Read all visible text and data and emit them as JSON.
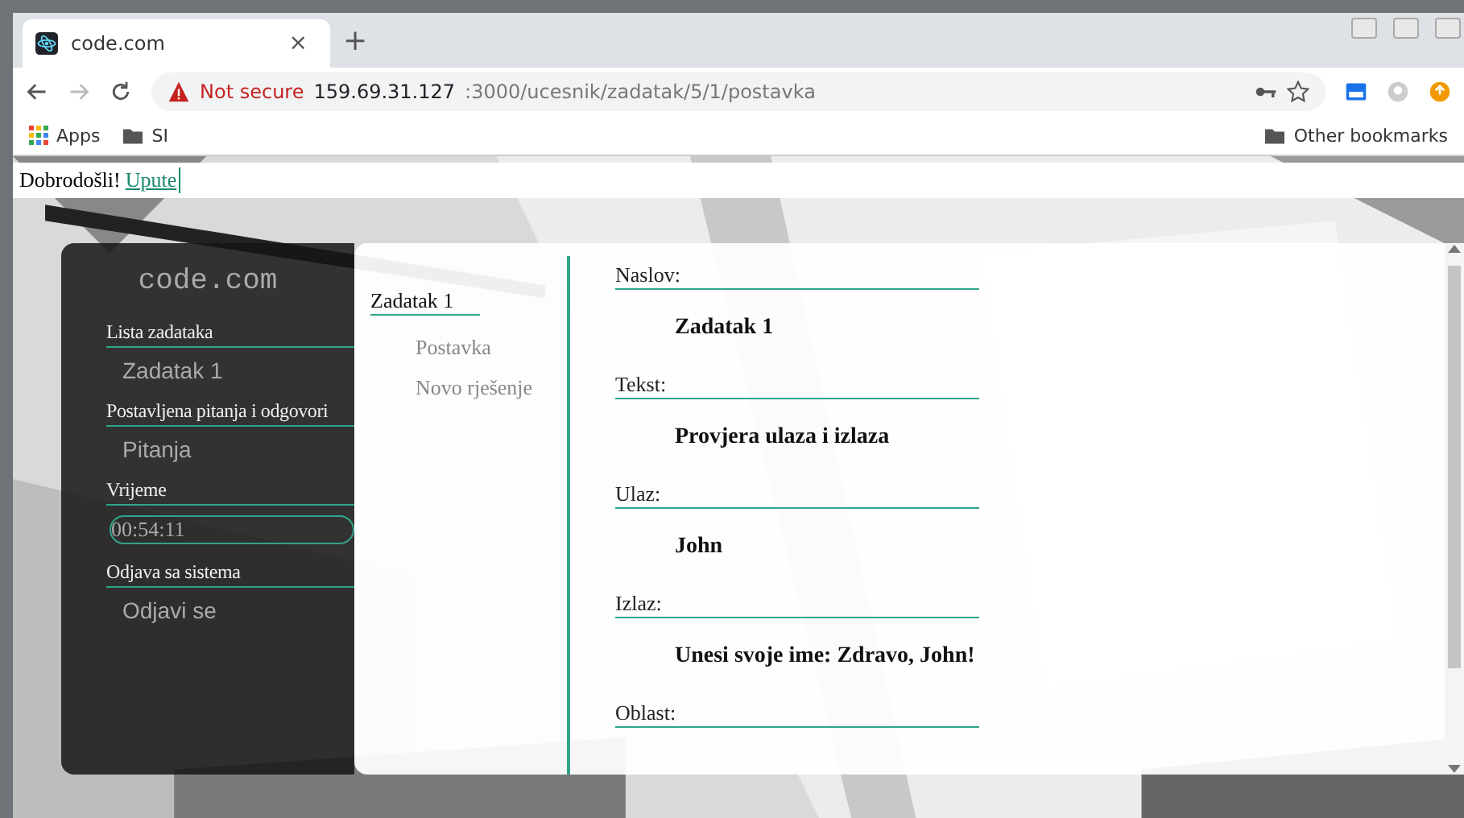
{
  "browser": {
    "tab_title": "code.com",
    "tab_close": "×",
    "new_tab": "+",
    "security": "Not secure",
    "url_host": "159.69.31.127",
    "url_path": ":3000/ucesnik/zadatak/5/1/postavka",
    "bookmarks": [
      {
        "label": "Apps",
        "kind": "apps"
      },
      {
        "label": "SI",
        "kind": "folder"
      }
    ],
    "other_bookmarks": "Other bookmarks"
  },
  "welcome": {
    "text": "Dobrodošli!",
    "link": "Upute"
  },
  "sidebar": {
    "logo": "code.com",
    "sections": [
      {
        "heading": "Lista zadataka",
        "kind": "link",
        "item": "Zadatak 1"
      },
      {
        "heading": "Postavljena pitanja i odgovori",
        "kind": "link",
        "item": "Pitanja"
      },
      {
        "heading": "Vrijeme",
        "kind": "timer",
        "item": "00:54:11"
      },
      {
        "heading": "Odjava sa sistema",
        "kind": "link",
        "item": "Odjavi se"
      }
    ]
  },
  "task_nav": {
    "title": "Zadatak 1",
    "items": [
      "Postavka",
      "Novo rješenje"
    ]
  },
  "fields": [
    {
      "label": "Naslov:",
      "value": "Zadatak 1"
    },
    {
      "label": "Tekst:",
      "value": "Provjera ulaza i izlaza"
    },
    {
      "label": "Ulaz:",
      "value": "John"
    },
    {
      "label": "Izlaz:",
      "value": "Unesi svoje ime: Zdravo, John!"
    },
    {
      "label": "Oblast:"
    }
  ]
}
